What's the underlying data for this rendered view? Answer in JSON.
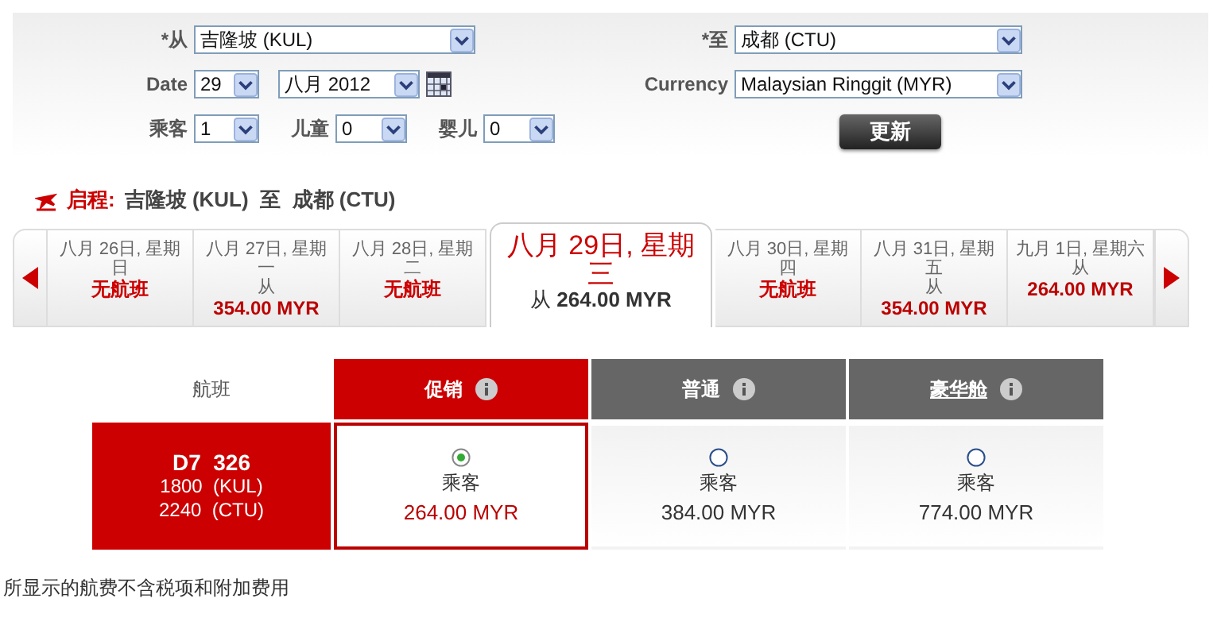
{
  "search_form": {
    "from": {
      "label": "*从",
      "value": "吉隆坡 (KUL)"
    },
    "to": {
      "label": "*至",
      "value": "成都 (CTU)"
    },
    "date": {
      "label": "Date",
      "day": "29",
      "month": "八月 2012"
    },
    "currency": {
      "label": "Currency",
      "value": "Malaysian Ringgit (MYR)"
    },
    "passengers": [
      {
        "label": "乘客",
        "value": "1"
      },
      {
        "label": "儿童",
        "value": "0"
      },
      {
        "label": "婴儿",
        "value": "0"
      }
    ],
    "update_button": "更新"
  },
  "itinerary": {
    "label": "启程:",
    "route": "吉隆坡 (KUL)  至  成都 (CTU)"
  },
  "date_tabs": [
    {
      "date": "八月 26日, 星期",
      "weekday": "日",
      "kind": "unavailable",
      "price": "无航班",
      "selected": false
    },
    {
      "date": "八月 27日, 星期",
      "weekday": "一",
      "kind": "fare",
      "from_label": "从",
      "price": "354.00 MYR",
      "selected": false
    },
    {
      "date": "八月 28日, 星期",
      "weekday": "二",
      "kind": "unavailable",
      "price": "无航班",
      "selected": false
    },
    {
      "date": "八月 29日, 星期",
      "weekday": "三",
      "kind": "fare",
      "from_label": "从",
      "price": "264.00 MYR",
      "selected": true
    },
    {
      "date": "八月 30日, 星期",
      "weekday": "四",
      "kind": "unavailable",
      "price": "无航班",
      "selected": false
    },
    {
      "date": "八月 31日, 星期",
      "weekday": "五",
      "kind": "fare",
      "from_label": "从",
      "price": "354.00 MYR",
      "selected": false
    },
    {
      "date": "九月 1日, 星期六",
      "kind": "fare",
      "from_label": "从",
      "price": "264.00 MYR",
      "selected": false
    }
  ],
  "fare_table": {
    "flight_header": "航班",
    "columns": [
      {
        "name": "促销",
        "selected": true,
        "link": false
      },
      {
        "name": "普通",
        "selected": false,
        "link": false
      },
      {
        "name": "豪华舱",
        "selected": false,
        "link": true
      }
    ],
    "rows": [
      {
        "flight": {
          "number": "D7  326",
          "depart": "1800  (KUL)",
          "arrive": "2240  (CTU)"
        },
        "fares": [
          {
            "label": "乘客",
            "price": "264.00 MYR",
            "selected": true
          },
          {
            "label": "乘客",
            "price": "384.00 MYR",
            "selected": false
          },
          {
            "label": "乘客",
            "price": "774.00 MYR",
            "selected": false
          }
        ]
      }
    ]
  },
  "footnote": "所显示的航费不含税项和附加费用"
}
